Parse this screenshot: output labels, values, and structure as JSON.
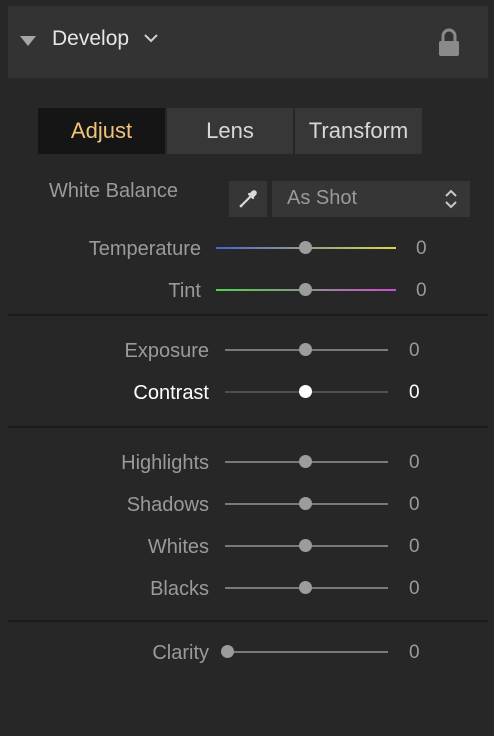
{
  "header": {
    "title": "Develop"
  },
  "tabs": [
    {
      "label": "Adjust",
      "active": true
    },
    {
      "label": "Lens",
      "active": false
    },
    {
      "label": "Transform",
      "active": false
    }
  ],
  "white_balance": {
    "label": "White Balance",
    "selected": "As Shot"
  },
  "sliders": {
    "temperature": {
      "label": "Temperature",
      "value": "0"
    },
    "tint": {
      "label": "Tint",
      "value": "0"
    },
    "exposure": {
      "label": "Exposure",
      "value": "0"
    },
    "contrast": {
      "label": "Contrast",
      "value": "0"
    },
    "highlights": {
      "label": "Highlights",
      "value": "0"
    },
    "shadows": {
      "label": "Shadows",
      "value": "0"
    },
    "whites": {
      "label": "Whites",
      "value": "0"
    },
    "blacks": {
      "label": "Blacks",
      "value": "0"
    },
    "clarity": {
      "label": "Clarity",
      "value": "0"
    }
  },
  "colors": {
    "accent_active_tab": "#f0c37a",
    "temperature_gradient": [
      "#4a63d6",
      "#d8d84a"
    ],
    "tint_gradient": [
      "#4cd64c",
      "#cf4ccf"
    ]
  }
}
